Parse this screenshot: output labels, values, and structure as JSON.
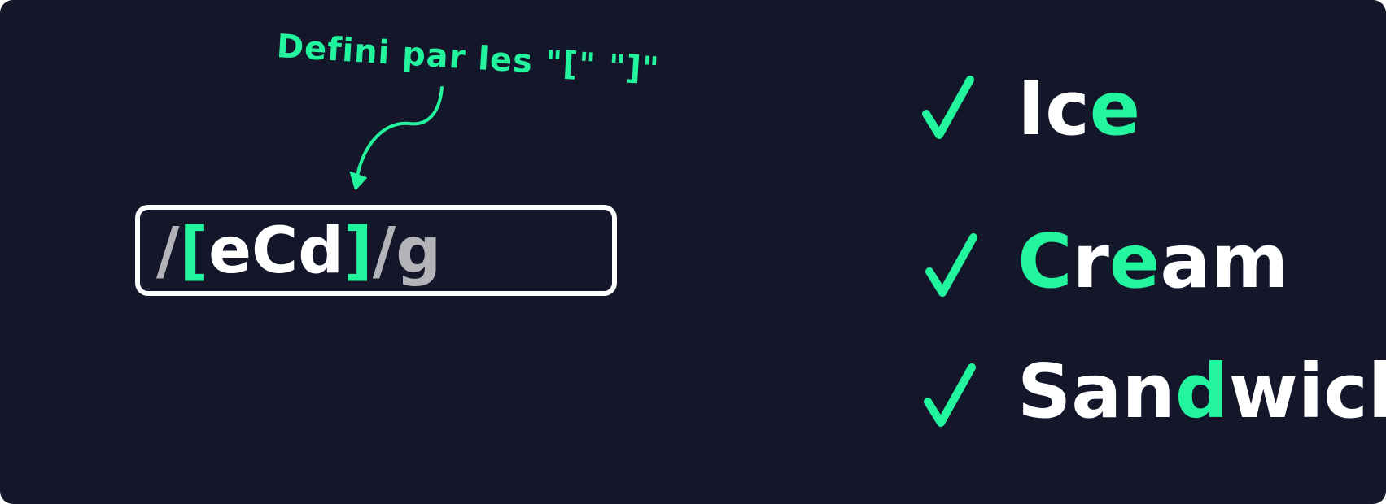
{
  "annotation": {
    "text": "Defini par les \"[\" \"]\""
  },
  "regex": {
    "parts": [
      {
        "text": "/",
        "color": "gray"
      },
      {
        "text": "[",
        "color": "green"
      },
      {
        "text": "eCd",
        "color": "white"
      },
      {
        "text": "]",
        "color": "green"
      },
      {
        "text": "/g",
        "color": "gray"
      }
    ]
  },
  "words": [
    {
      "parts": [
        {
          "text": "Ic",
          "color": "white"
        },
        {
          "text": "e",
          "color": "green"
        }
      ]
    },
    {
      "parts": [
        {
          "text": "C",
          "color": "green"
        },
        {
          "text": "r",
          "color": "white"
        },
        {
          "text": "e",
          "color": "green"
        },
        {
          "text": "am",
          "color": "white"
        }
      ]
    },
    {
      "parts": [
        {
          "text": "San",
          "color": "white"
        },
        {
          "text": "d",
          "color": "green"
        },
        {
          "text": "wich",
          "color": "white"
        }
      ]
    }
  ],
  "colors": {
    "background": "#14162a",
    "accent": "#22f59e",
    "text": "#ffffff",
    "muted": "#b3b3b8"
  },
  "icons": {
    "check": "check-icon",
    "arrow": "curved-arrow-icon"
  }
}
